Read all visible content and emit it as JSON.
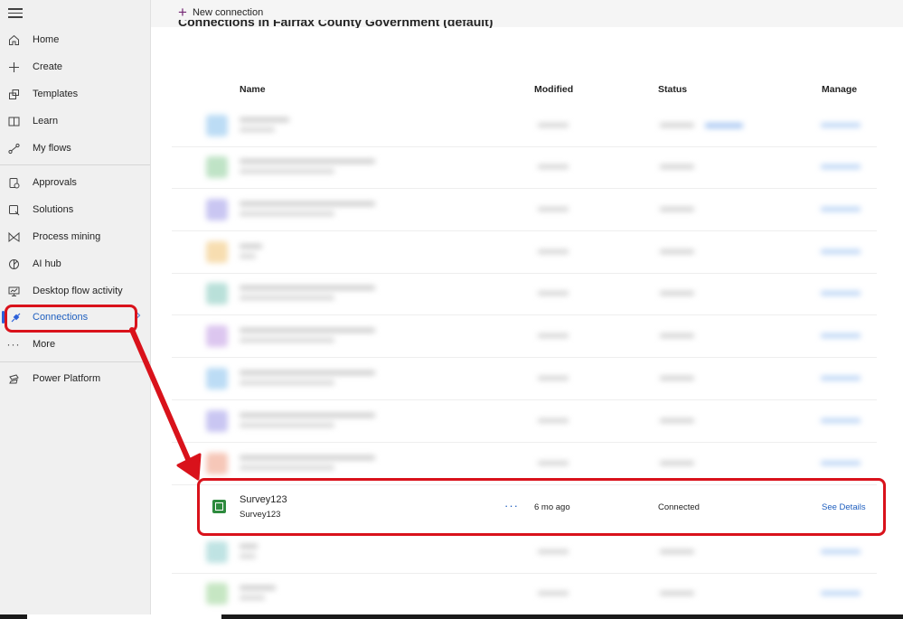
{
  "sidebar": {
    "items": [
      {
        "label": "Home",
        "icon": "home-icon"
      },
      {
        "label": "Create",
        "icon": "plus-icon"
      },
      {
        "label": "Templates",
        "icon": "templates-icon"
      },
      {
        "label": "Learn",
        "icon": "book-icon"
      },
      {
        "label": "My flows",
        "icon": "flows-icon"
      },
      {
        "label": "Approvals",
        "icon": "approvals-icon"
      },
      {
        "label": "Solutions",
        "icon": "solutions-icon"
      },
      {
        "label": "Process mining",
        "icon": "process-mining-icon"
      },
      {
        "label": "AI hub",
        "icon": "ai-hub-icon"
      },
      {
        "label": "Desktop flow activity",
        "icon": "desktop-flow-icon"
      },
      {
        "label": "Connections",
        "icon": "connections-icon",
        "active": true
      },
      {
        "label": "More",
        "icon": "more-icon"
      },
      {
        "label": "Power Platform",
        "icon": "power-platform-icon"
      }
    ]
  },
  "toolbar": {
    "new_connection_label": "New connection"
  },
  "page": {
    "title": "Connections in Fairfax County Government (default)"
  },
  "table": {
    "columns": [
      "Name",
      "Modified",
      "Status",
      "Manage"
    ],
    "highlighted_row": {
      "name": "Survey123",
      "subtitle": "Survey123",
      "more": "···",
      "modified": "6 mo ago",
      "status": "Connected",
      "manage": "See Details"
    }
  },
  "colors": {
    "accent": "#742774",
    "link": "#1f5fbf",
    "annotation": "#d9121b",
    "survey_icon": "#2e8b3e"
  }
}
